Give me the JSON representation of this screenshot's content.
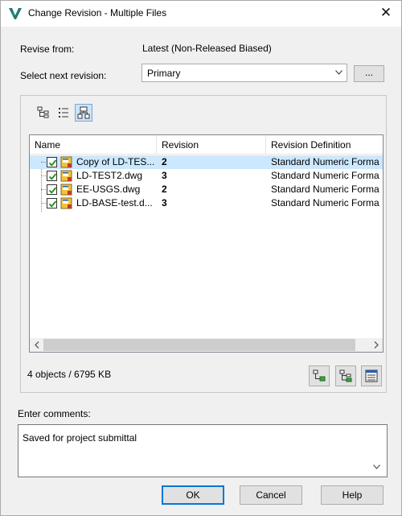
{
  "window": {
    "title": "Change Revision - Multiple Files",
    "close_glyph": "✕"
  },
  "form": {
    "revise_from_label": "Revise from:",
    "revise_from_value": "Latest (Non-Released Biased)",
    "next_revision_label": "Select next revision:",
    "next_revision_value": "Primary",
    "browse_label": "..."
  },
  "toolbar": {
    "icons": [
      "tree-view-icon",
      "list-view-icon",
      "structure-view-icon"
    ]
  },
  "list": {
    "columns": [
      "Name",
      "Revision",
      "Revision Definition"
    ],
    "rows": [
      {
        "name": "Copy of LD-TES...",
        "revision": "2",
        "definition": "Standard Numeric Forma",
        "selected": true
      },
      {
        "name": "LD-TEST2.dwg",
        "revision": "3",
        "definition": "Standard Numeric Forma",
        "selected": false
      },
      {
        "name": "EE-USGS.dwg",
        "revision": "2",
        "definition": "Standard Numeric Forma",
        "selected": false
      },
      {
        "name": "LD-BASE-test.d...",
        "revision": "3",
        "definition": "Standard Numeric Forma",
        "selected": false
      }
    ]
  },
  "status": {
    "summary": "4 objects / 6795 KB"
  },
  "comments": {
    "label": "Enter comments:",
    "value": "Saved for project submittal"
  },
  "buttons": {
    "ok": "OK",
    "cancel": "Cancel",
    "help": "Help"
  },
  "colors": {
    "selection": "#cce8ff",
    "accent": "#0078d7",
    "app_icon": "#1f7a6d"
  }
}
